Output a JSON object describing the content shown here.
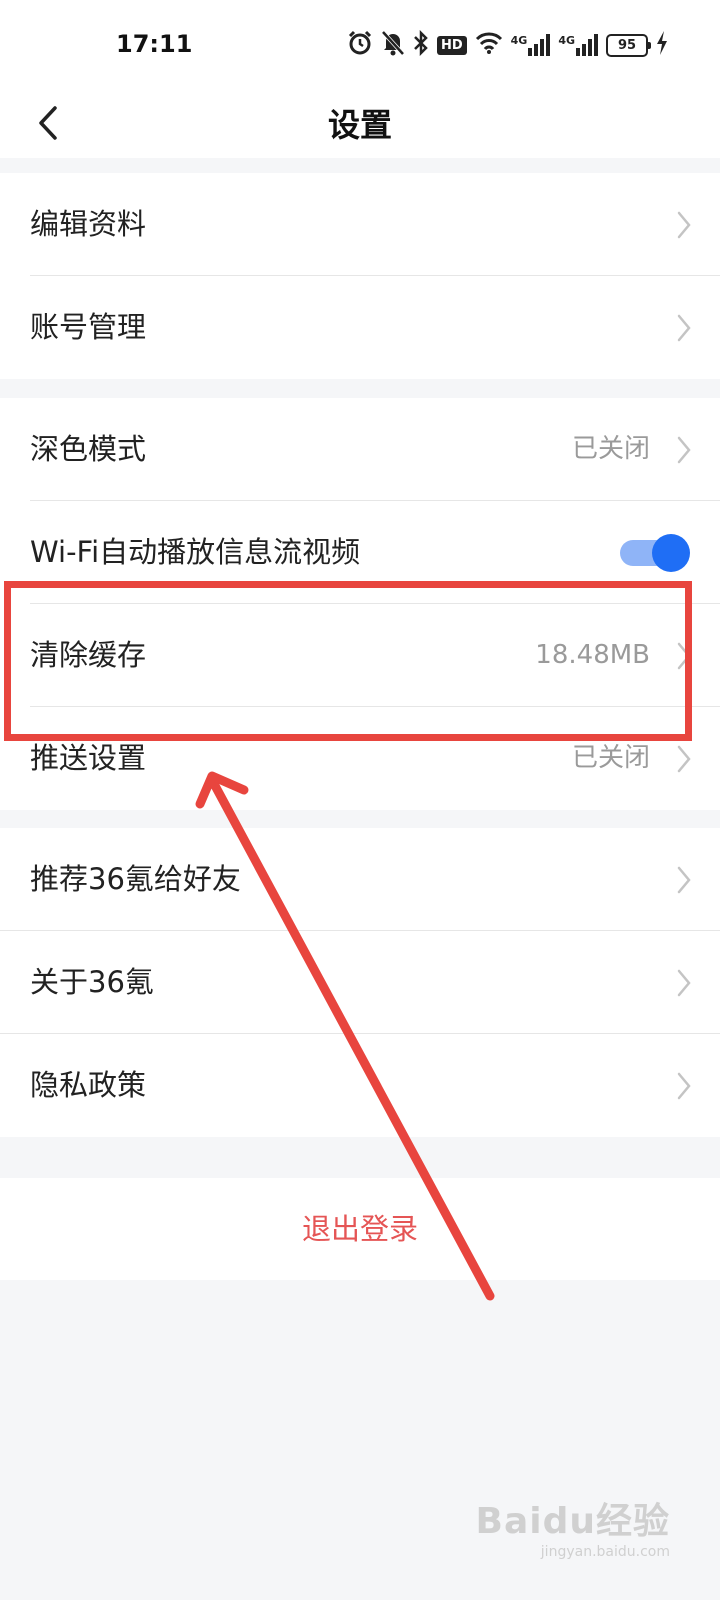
{
  "status_bar": {
    "time": "17:11",
    "hd_label": "HD",
    "network_1": "4G",
    "network_2": "4G",
    "battery": "95"
  },
  "header": {
    "title": "设置"
  },
  "groups": [
    {
      "items": [
        {
          "label": "编辑资料",
          "value": ""
        },
        {
          "label": "账号管理",
          "value": ""
        }
      ]
    },
    {
      "items": [
        {
          "label": "深色模式",
          "value": "已关闭"
        },
        {
          "label": "Wi-Fi自动播放信息流视频",
          "toggle": true
        },
        {
          "label": "清除缓存",
          "value": "18.48MB"
        },
        {
          "label": "推送设置",
          "value": "已关闭"
        }
      ]
    },
    {
      "items": [
        {
          "label": "推荐36氪给好友",
          "value": ""
        },
        {
          "label": "关于36氪",
          "value": ""
        },
        {
          "label": "隐私政策",
          "value": ""
        }
      ]
    }
  ],
  "logout_label": "退出登录",
  "watermark": {
    "logo": "Baidu经验",
    "url": "jingyan.baidu.com"
  },
  "colors": {
    "accent_blue": "#1f6ef5",
    "logout_red": "#e55555",
    "annotation_red": "#e8453e",
    "background": "#f5f6f8"
  }
}
